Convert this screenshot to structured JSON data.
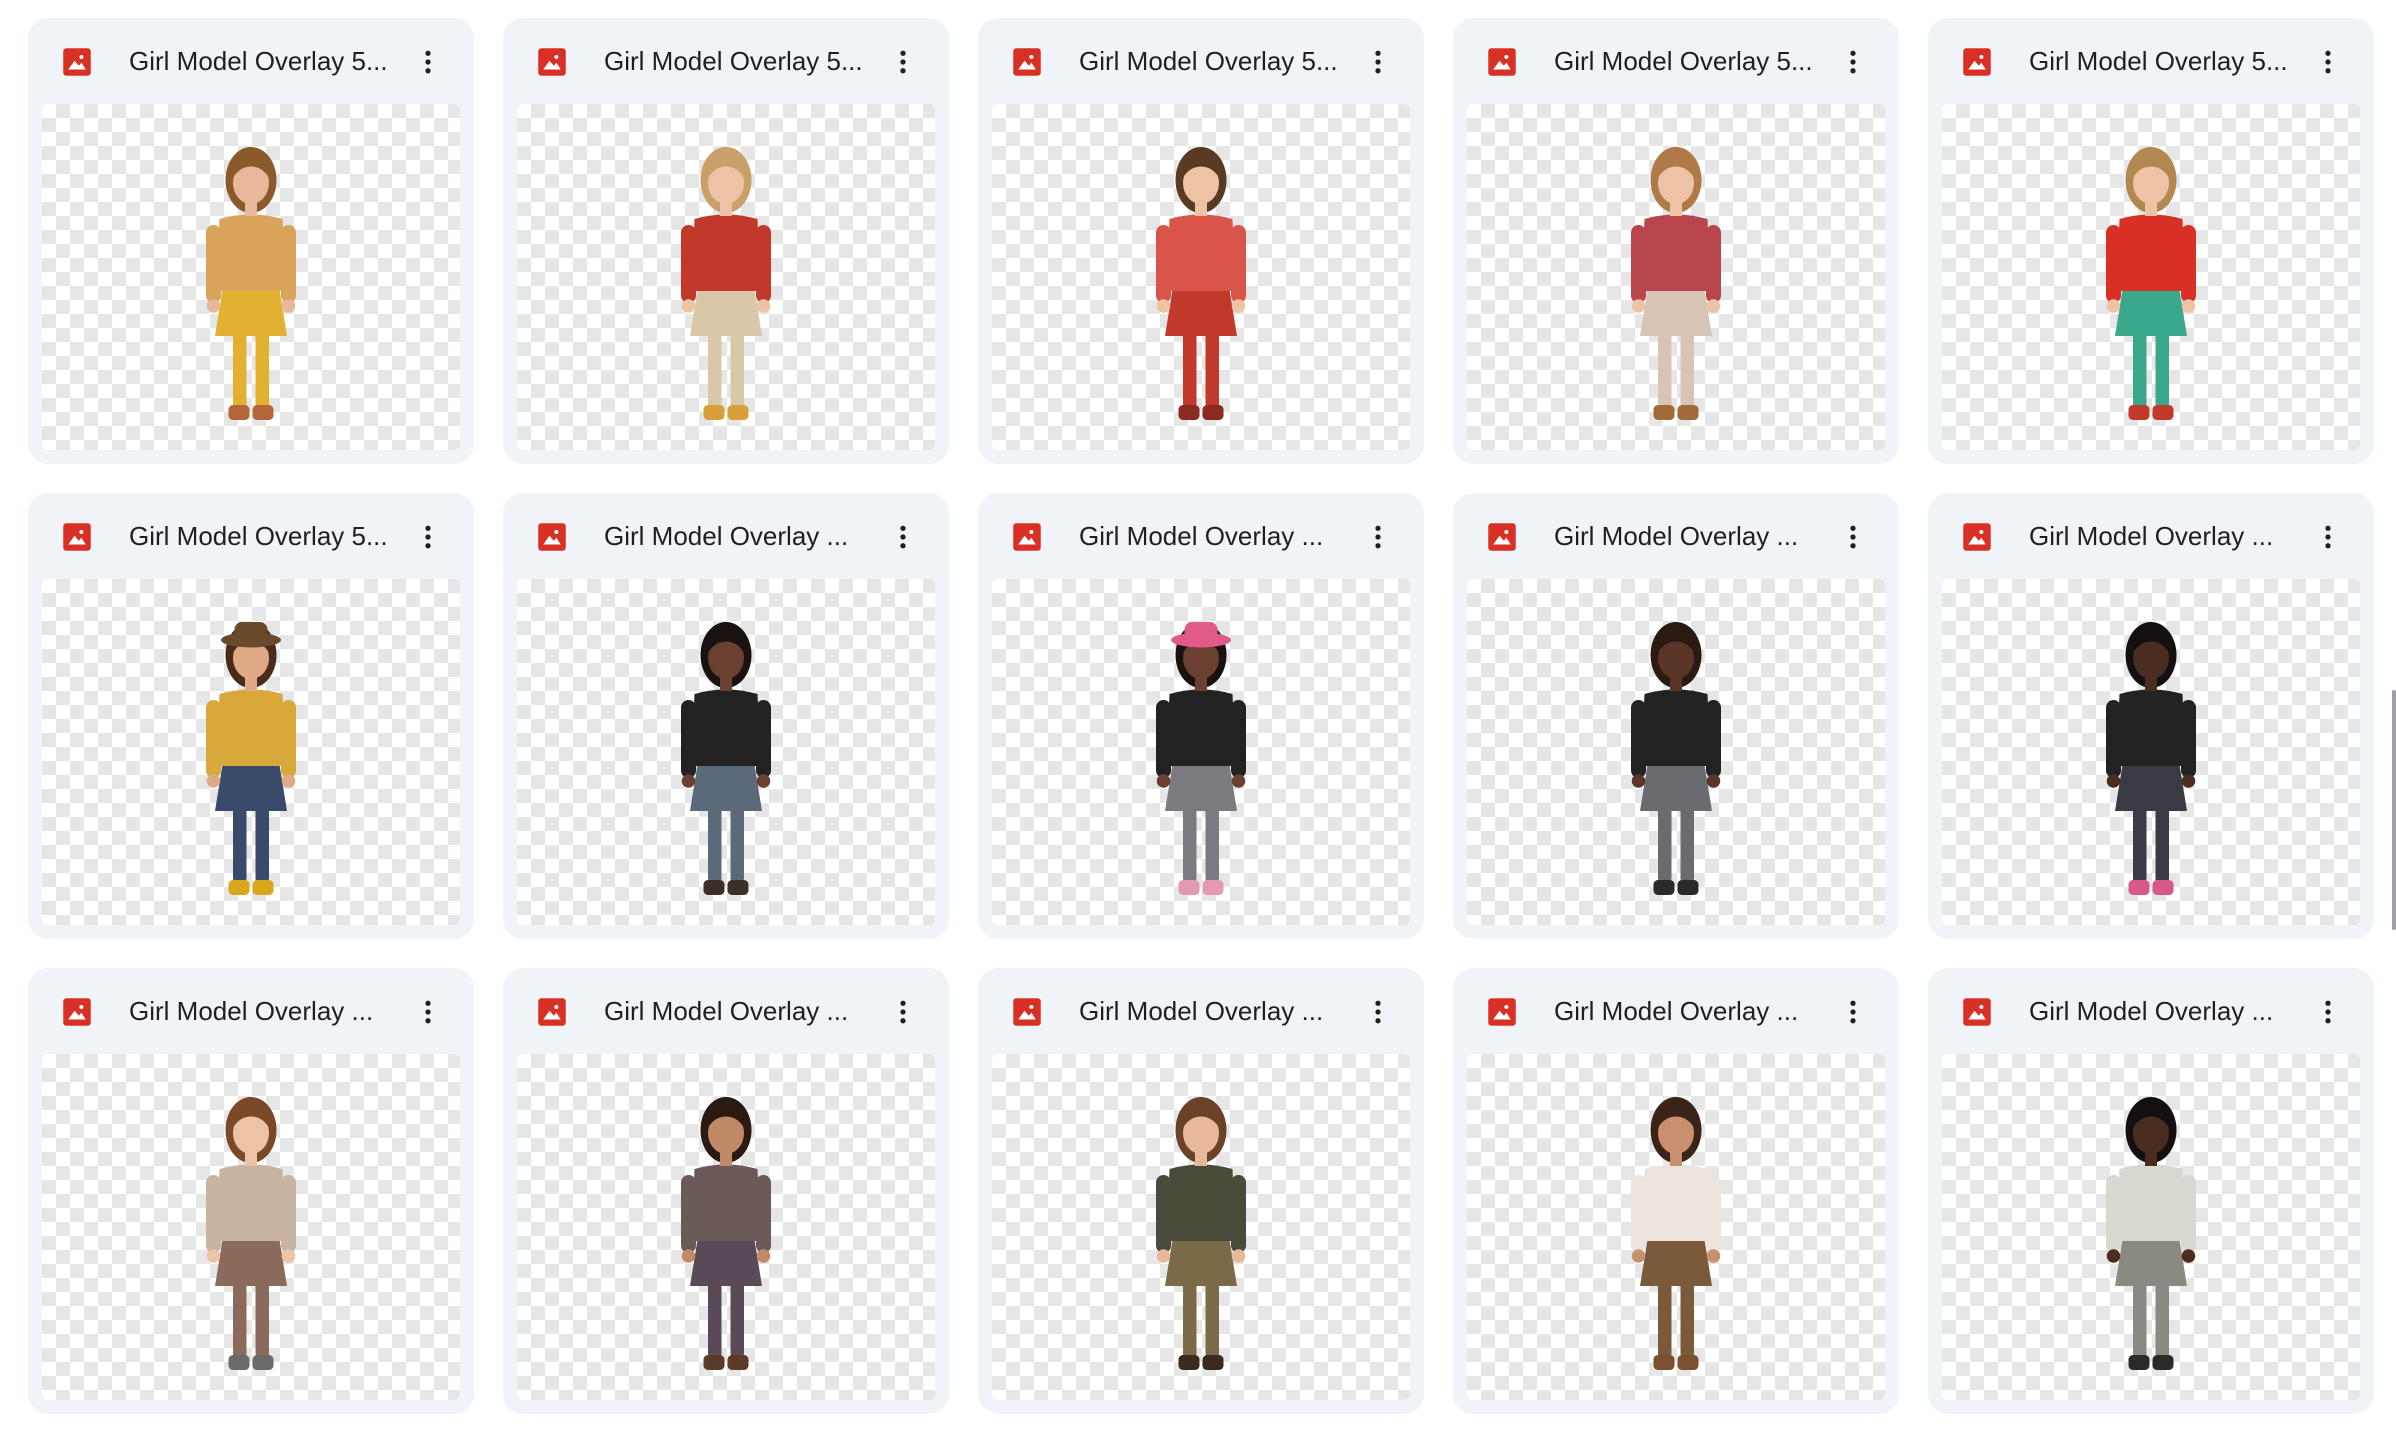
{
  "accent": "#d93025",
  "files": [
    {
      "name": "Girl Model Overlay 5...",
      "icon": "image-file-icon",
      "figure": {
        "skin": "#e8b89a",
        "hair": "#8a5a2b",
        "top": "#d9a35a",
        "bottom": "#e2b131",
        "shoes": "#b5653a",
        "hat": ""
      }
    },
    {
      "name": "Girl Model Overlay 5...",
      "icon": "image-file-icon",
      "figure": {
        "skin": "#eec3a5",
        "hair": "#c9a06a",
        "top": "#c0392b",
        "bottom": "#d8c8a8",
        "shoes": "#d9a03a",
        "hat": ""
      }
    },
    {
      "name": "Girl Model Overlay 5...",
      "icon": "image-file-icon",
      "figure": {
        "skin": "#eec3a5",
        "hair": "#5a3a22",
        "top": "#d9554a",
        "bottom": "#c0392b",
        "shoes": "#8a2a20",
        "hat": ""
      }
    },
    {
      "name": "Girl Model Overlay 5...",
      "icon": "image-file-icon",
      "figure": {
        "skin": "#eec3a5",
        "hair": "#b07a48",
        "top": "#b8454c",
        "bottom": "#d8c4b4",
        "shoes": "#a06a3a",
        "hat": ""
      }
    },
    {
      "name": "Girl Model Overlay 5...",
      "icon": "image-file-icon",
      "figure": {
        "skin": "#eec3a5",
        "hair": "#b08850",
        "top": "#d93025",
        "bottom": "#3aa88a",
        "shoes": "#c0392b",
        "hat": ""
      }
    },
    {
      "name": "Girl Model Overlay 5...",
      "icon": "image-file-icon",
      "figure": {
        "skin": "#e0aa88",
        "hair": "#4a2a18",
        "top": "#d8a83a",
        "bottom": "#3a4a6a",
        "shoes": "#d9a81a",
        "hat": "#6a4a2a"
      }
    },
    {
      "name": "Girl Model Overlay ...",
      "icon": "image-file-icon",
      "figure": {
        "skin": "#6a4030",
        "hair": "#1a1210",
        "top": "#222222",
        "bottom": "#5a6a7a",
        "shoes": "#3a3028",
        "hat": ""
      }
    },
    {
      "name": "Girl Model Overlay ...",
      "icon": "image-file-icon",
      "figure": {
        "skin": "#6a4030",
        "hair": "#1a1210",
        "top": "#222222",
        "bottom": "#7a7a80",
        "shoes": "#e39ab0",
        "hat": "#e05a8a"
      }
    },
    {
      "name": "Girl Model Overlay ...",
      "icon": "image-file-icon",
      "figure": {
        "skin": "#5a3628",
        "hair": "#2a1a12",
        "top": "#222222",
        "bottom": "#6a6a70",
        "shoes": "#2a2a2a",
        "hat": ""
      }
    },
    {
      "name": "Girl Model Overlay ...",
      "icon": "image-file-icon",
      "figure": {
        "skin": "#4a2c20",
        "hair": "#151010",
        "top": "#222222",
        "bottom": "#3a3a45",
        "shoes": "#d8588a",
        "hat": ""
      }
    },
    {
      "name": "Girl Model Overlay ...",
      "icon": "image-file-icon",
      "figure": {
        "skin": "#eec3a5",
        "hair": "#7a4a28",
        "top": "#c8b4a0",
        "bottom": "#8a6a5a",
        "shoes": "#6a6a6a",
        "hat": ""
      }
    },
    {
      "name": "Girl Model Overlay ...",
      "icon": "image-file-icon",
      "figure": {
        "skin": "#c08a68",
        "hair": "#2a1a12",
        "top": "#6a5a58",
        "bottom": "#5a4a58",
        "shoes": "#5a3a28",
        "hat": ""
      }
    },
    {
      "name": "Girl Model Overlay ...",
      "icon": "image-file-icon",
      "figure": {
        "skin": "#e8b89a",
        "hair": "#6a4228",
        "top": "#4a4a3a",
        "bottom": "#7a6a48",
        "shoes": "#3a2a20",
        "hat": ""
      }
    },
    {
      "name": "Girl Model Overlay ...",
      "icon": "image-file-icon",
      "figure": {
        "skin": "#c89070",
        "hair": "#3a2418",
        "top": "#ece4dc",
        "bottom": "#7a5a3a",
        "shoes": "#7a5030",
        "hat": ""
      }
    },
    {
      "name": "Girl Model Overlay ...",
      "icon": "image-file-icon",
      "figure": {
        "skin": "#4a2c20",
        "hair": "#151010",
        "top": "#d8d8d0",
        "bottom": "#8a8a82",
        "shoes": "#2a2a2a",
        "hat": ""
      }
    }
  ]
}
